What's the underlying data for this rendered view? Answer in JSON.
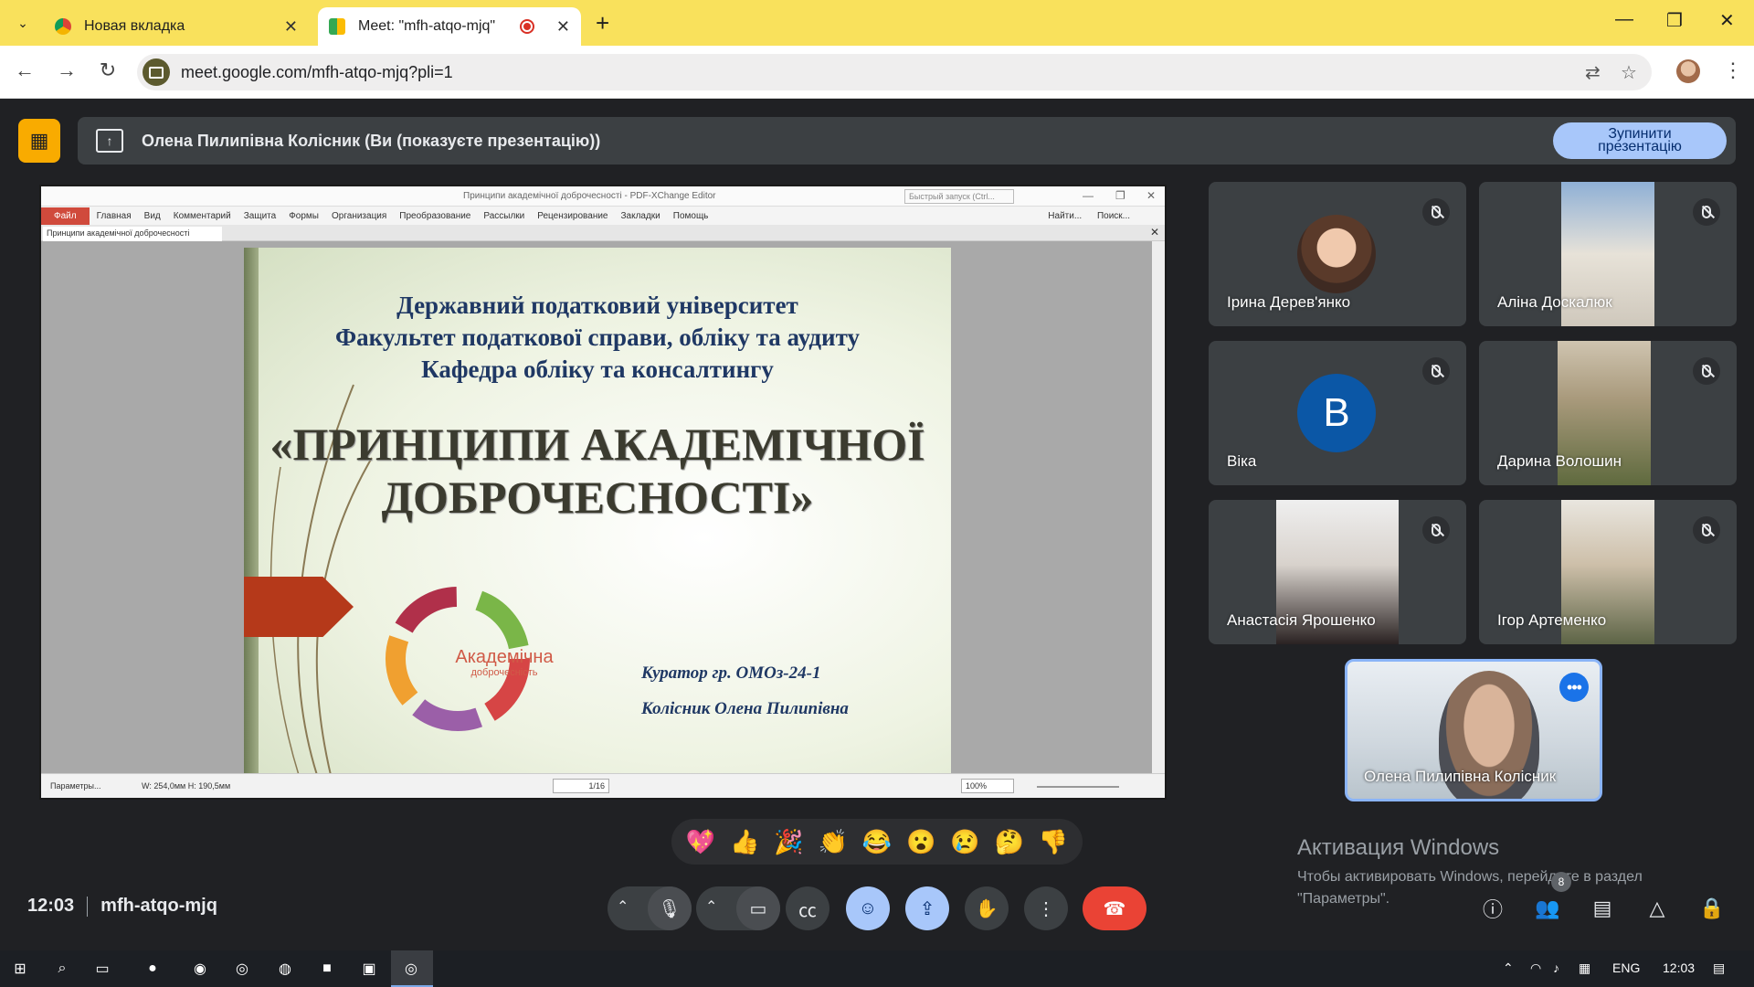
{
  "browser": {
    "tabs": [
      {
        "title": "Новая вкладка",
        "active": false
      },
      {
        "title": "Meet: \"mfh-atqo-mjq\"",
        "active": true
      }
    ],
    "url": "meet.google.com/mfh-atqo-mjq?pli=1",
    "icons": [
      "tab-list-icon",
      "back-icon",
      "forward-icon",
      "reload-icon",
      "translate-icon",
      "star-icon",
      "profile-avatar",
      "menu-icon"
    ]
  },
  "presenting": {
    "text": "Олена Пилипівна Колісник (Ви (показуєте презентацію))",
    "stop_label": "Зупинити презентацію"
  },
  "pdf": {
    "window_title": "Принципи академічної доброчесності - PDF-XChange Editor",
    "quick_launch": "Быстрый запуск (Ctrl...",
    "menu": [
      "Файл",
      "Главная",
      "Вид",
      "Комментарий",
      "Защита",
      "Формы",
      "Организация",
      "Преобразование",
      "Рассылки",
      "Рецензирование",
      "Закладки",
      "Помощь"
    ],
    "find": "Найти...",
    "search": "Поиск...",
    "doc_tab": "Принципи академічної доброчесності",
    "status_params": "Параметры...",
    "dims": "W: 254,0мм  H: 190,5мм",
    "page": "1/16",
    "zoom": "100%"
  },
  "slide": {
    "line1": "Державний податковий університет",
    "line2": "Факультет податкової справи, обліку та аудиту",
    "line3": "Кафедра обліку та консалтингу",
    "title1": "«ПРИНЦИПИ АКАДЕМІЧНОЇ",
    "title2": "ДОБРОЧЕСНОСТІ»",
    "cycle_label": "Академічна",
    "cycle_sub": "доброчесність",
    "curator": "Куратор гр. ОМОз-24-1",
    "curator_name": "Колісник Олена Пилипівна"
  },
  "participants": [
    {
      "name": "Ірина Дерев'янко"
    },
    {
      "name": "Аліна Доскалюк"
    },
    {
      "name": "Віка",
      "initial": "В"
    },
    {
      "name": "Дарина Волошин"
    },
    {
      "name": "Анастасія Ярошенко"
    },
    {
      "name": "Ігор Артеменко"
    }
  ],
  "self": {
    "name": "Олена Пилипівна Колісник"
  },
  "reactions": [
    "💖",
    "👍",
    "🎉",
    "👏",
    "😂",
    "😮",
    "😢",
    "🤔",
    "👎"
  ],
  "activation": {
    "title": "Активация Windows",
    "line1": "Чтобы активировать Windows, перейдите в раздел",
    "line2": "\"Параметры\"."
  },
  "meeting": {
    "time": "12:03",
    "code": "mfh-atqo-mjq",
    "participant_count": "8"
  },
  "taskbar": {
    "lang": "ENG",
    "time": "12:03"
  },
  "colors": {
    "chrome_tab_bar": "#f9e15c",
    "meet_bg": "#202124",
    "stop_button": "#a8c7fa",
    "end_call": "#ea4335",
    "present_accent": "#f9ab00"
  }
}
